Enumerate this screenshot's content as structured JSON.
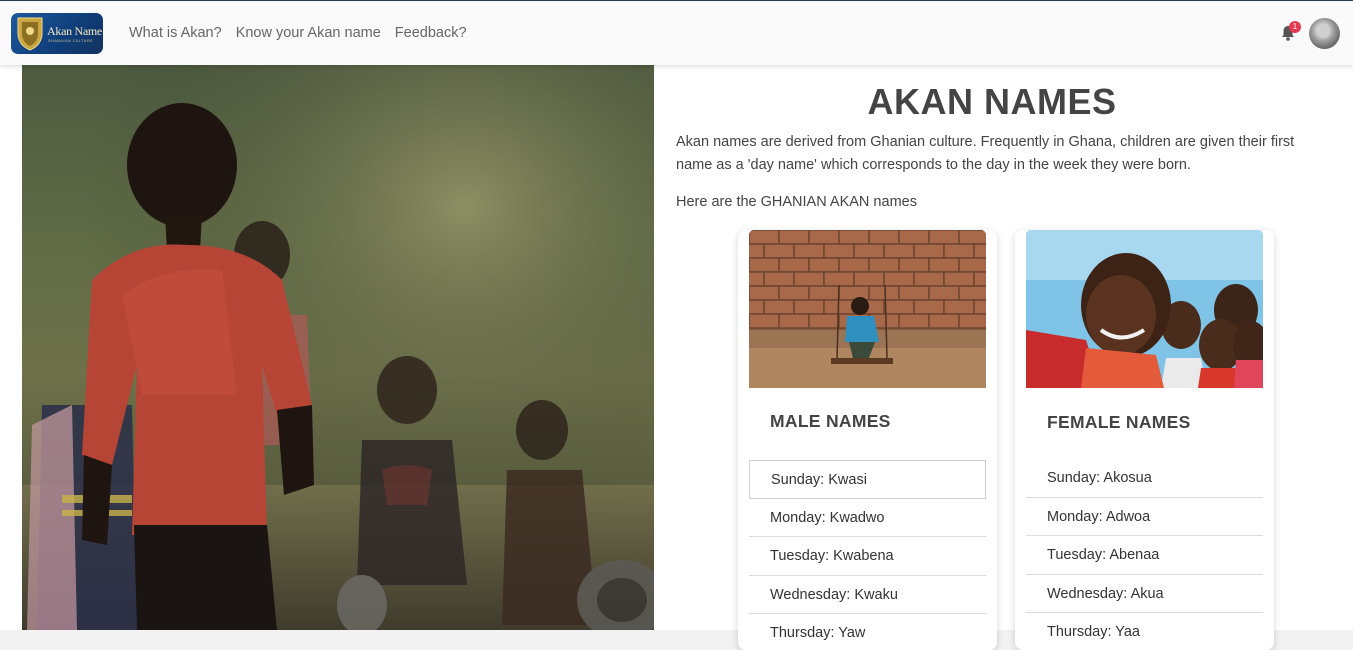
{
  "navbar": {
    "logo_text": "Akan Name",
    "logo_subtext": "GHANAIAN CULTURE",
    "links": [
      "What is Akan?",
      "Know your Akan name",
      "Feedback?"
    ],
    "notification_count": "1"
  },
  "main": {
    "title": "AKAN NAMES",
    "intro": "Akan names are derived from Ghanian culture. Frequently in Ghana, children are given their first name as a 'day name' which corresponds to the day in the week they were born.",
    "subheading": "Here are the GHANIAN AKAN names"
  },
  "cards": {
    "male": {
      "title": "MALE NAMES",
      "items": [
        "Sunday: Kwasi",
        "Monday: Kwadwo",
        "Tuesday: Kwabena",
        "Wednesday: Kwaku",
        "Thursday: Yaw"
      ]
    },
    "female": {
      "title": "FEMALE NAMES",
      "items": [
        "Sunday: Akosua",
        "Monday: Adwoa",
        "Tuesday: Abenaa",
        "Wednesday: Akua",
        "Thursday: Yaa"
      ]
    }
  },
  "icons": {
    "logo": "akan-shield-icon",
    "notification": "bell-icon",
    "avatar": "user-avatar"
  },
  "colors": {
    "navbar_bg": "#fafafa",
    "logo_bg": "#1e5aa0",
    "badge": "#e53950",
    "text": "#444444"
  }
}
